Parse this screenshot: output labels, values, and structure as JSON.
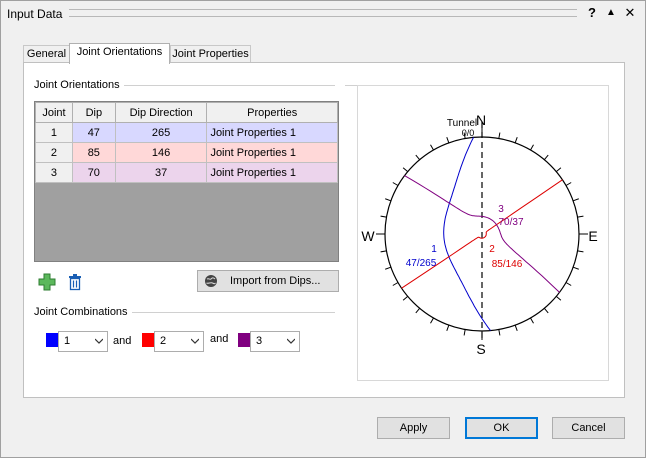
{
  "window": {
    "title": "Input Data",
    "help_glyph": "?",
    "pin_glyph": "▲",
    "close_glyph": "✕"
  },
  "tabs": [
    {
      "label": "General"
    },
    {
      "label": "Joint Orientations"
    },
    {
      "label": "Joint Properties"
    }
  ],
  "orientations": {
    "group_label": "Joint Orientations",
    "columns": [
      "Joint",
      "Dip",
      "Dip Direction",
      "Properties"
    ],
    "rows": [
      {
        "joint": "1",
        "dip": "47",
        "dip_direction": "265",
        "properties": "Joint Properties 1"
      },
      {
        "joint": "2",
        "dip": "85",
        "dip_direction": "146",
        "properties": "Joint Properties 1"
      },
      {
        "joint": "3",
        "dip": "70",
        "dip_direction": "37",
        "properties": "Joint Properties 1"
      }
    ],
    "add_icon": "plus-icon",
    "delete_icon": "trash-icon",
    "import_label": "Import from Dips..."
  },
  "combinations": {
    "group_label": "Joint Combinations",
    "items": [
      {
        "color": "#0000ff",
        "value": "1"
      },
      {
        "color": "#ff0000",
        "value": "2"
      },
      {
        "color": "#800080",
        "value": "3"
      }
    ],
    "and_label": "and"
  },
  "stereonet": {
    "north": "N",
    "south": "S",
    "east": "E",
    "west": "W",
    "tunnel_label": "Tunnel",
    "tunnel_value": "0/0",
    "joints": [
      {
        "id": "1",
        "label": "47/265",
        "color": "#0000cc"
      },
      {
        "id": "2",
        "label": "85/146",
        "color": "#dd0000"
      },
      {
        "id": "3",
        "label": "70/37",
        "color": "#800080"
      }
    ]
  },
  "buttons": {
    "apply": "Apply",
    "ok": "OK",
    "cancel": "Cancel"
  }
}
